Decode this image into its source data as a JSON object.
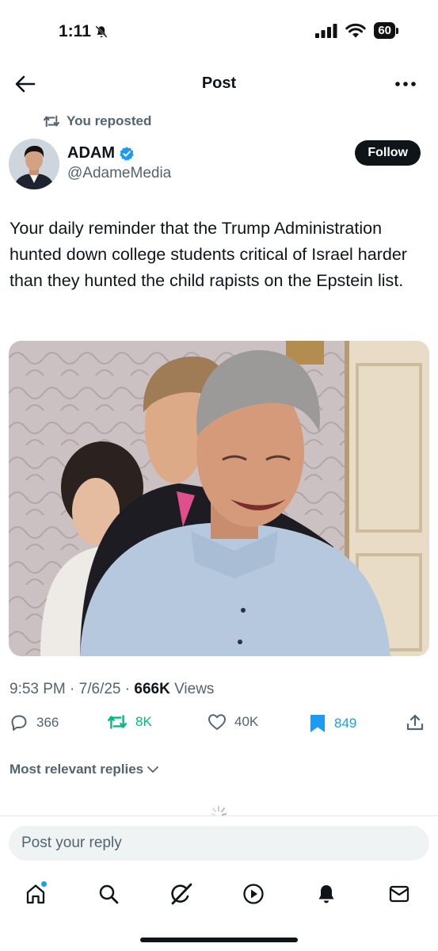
{
  "status_bar": {
    "time": "1:11",
    "battery": "60"
  },
  "header": {
    "title": "Post"
  },
  "repost": {
    "label": "You reposted"
  },
  "author": {
    "name": "ADAM",
    "handle": "@AdameMedia",
    "follow_label": "Follow"
  },
  "tweet": {
    "text": "Your daily reminder that the Trump Administration hunted down college students critical of Israel harder than they hunted the child rapists on the Epstein list."
  },
  "meta": {
    "time": "9:53 PM",
    "date": "7/6/25",
    "views_count": "666K",
    "views_label": "Views",
    "separator": "·"
  },
  "actions": {
    "replies": "366",
    "reposts": "8K",
    "likes": "40K",
    "bookmarks": "849"
  },
  "replies": {
    "sort_label": "Most relevant replies"
  },
  "reply_box": {
    "placeholder": "Post your reply"
  },
  "colors": {
    "accent": "#1d9bf0",
    "repost_green": "#00ba7c",
    "text_primary": "#0f1419",
    "text_secondary": "#536471"
  },
  "icons": [
    "back-arrow-icon",
    "more-icon",
    "repost-icon",
    "verified-icon",
    "reply-icon",
    "like-icon",
    "bookmark-icon",
    "share-icon",
    "chevron-down-icon",
    "home-icon",
    "search-icon",
    "grok-icon",
    "video-icon",
    "bell-icon",
    "mail-icon"
  ]
}
